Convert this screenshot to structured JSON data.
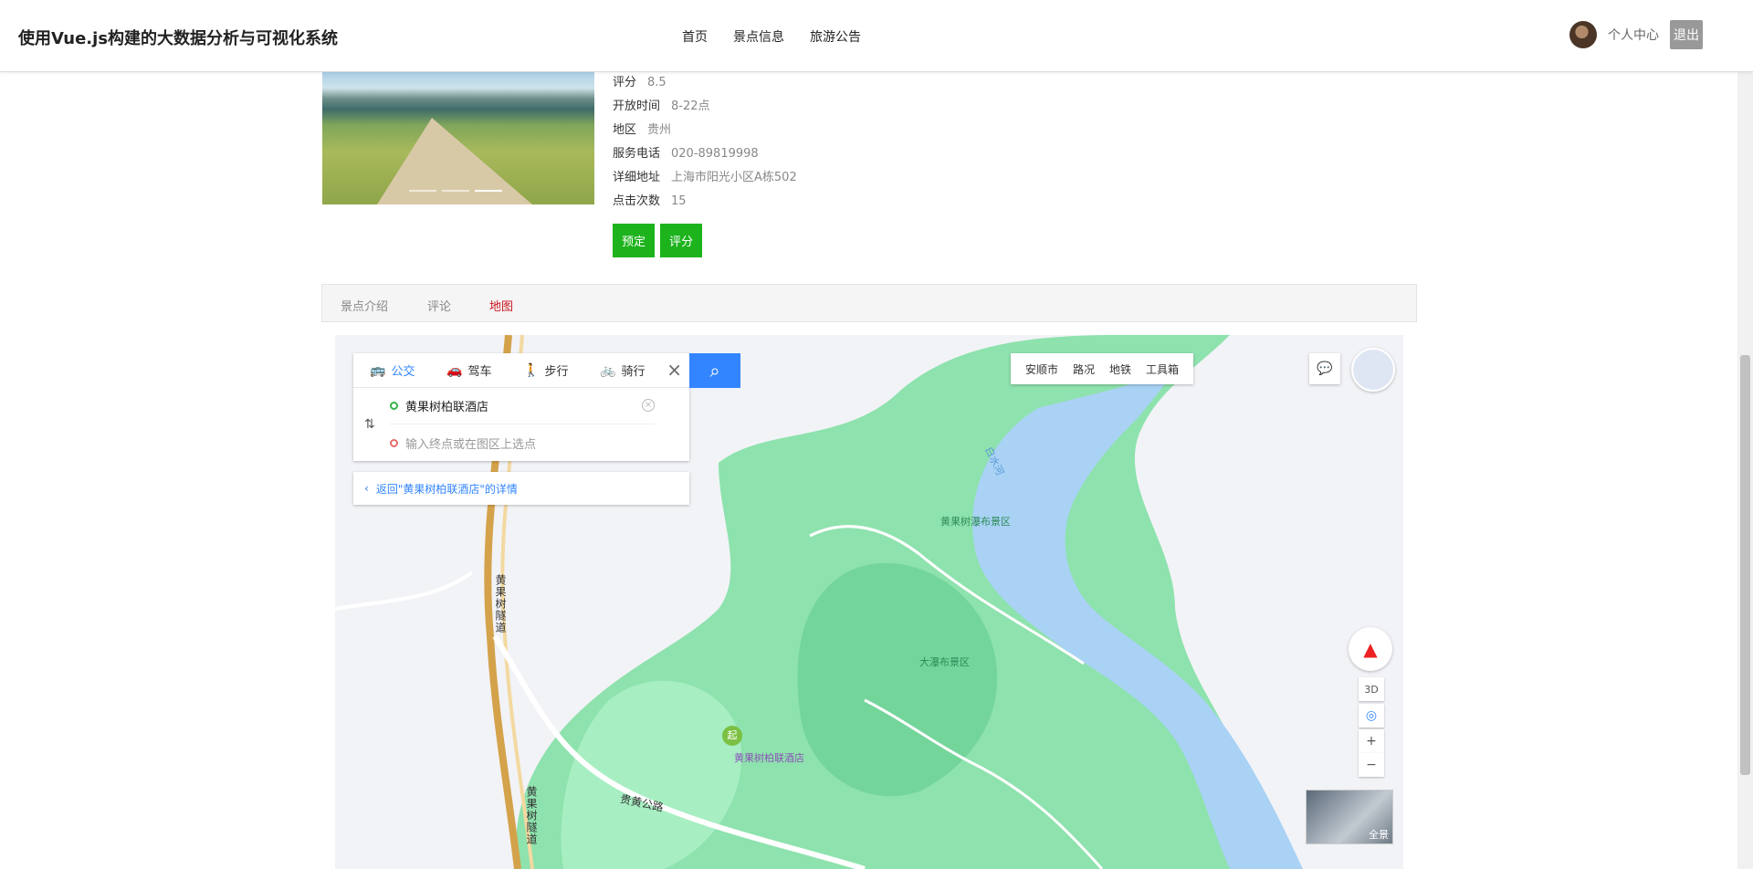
{
  "header": {
    "site_title": "使用Vue.js构建的大数据分析与可视化系统",
    "nav": [
      "首页",
      "景点信息",
      "旅游公告"
    ],
    "user_center": "个人中心",
    "logout": "退出"
  },
  "details": {
    "rows": [
      {
        "label": "评分",
        "value": "8.5"
      },
      {
        "label": "开放时间",
        "value": "8-22点"
      },
      {
        "label": "地区",
        "value": "贵州"
      },
      {
        "label": "服务电话",
        "value": "020-89819998"
      },
      {
        "label": "详细地址",
        "value": "上海市阳光小区A栋502"
      },
      {
        "label": "点击次数",
        "value": "15"
      }
    ],
    "book_button": "预定",
    "rate_button": "评分"
  },
  "tabs": [
    "景点介绍",
    "评论",
    "地图"
  ],
  "active_tab": "地图",
  "map": {
    "modes": [
      "公交",
      "驾车",
      "步行",
      "骑行"
    ],
    "start_value": "黄果树柏联酒店",
    "end_placeholder": "输入终点或在图区上选点",
    "back_link": "返回\"黄果树柏联酒店\"的详情",
    "toolbar": [
      "安顺市",
      "路况",
      "地铁",
      "工具箱"
    ],
    "labels": {
      "waterfall": "黄果树瀑布景区",
      "dabubu": "大瀑布景区",
      "hotel": "黄果树柏联酒店",
      "tunnel": "黄果树隧道",
      "road": "贵黄公路",
      "start_marker": "起",
      "river": "白水河",
      "streetview": "全景",
      "compass_3d": "3D"
    }
  }
}
